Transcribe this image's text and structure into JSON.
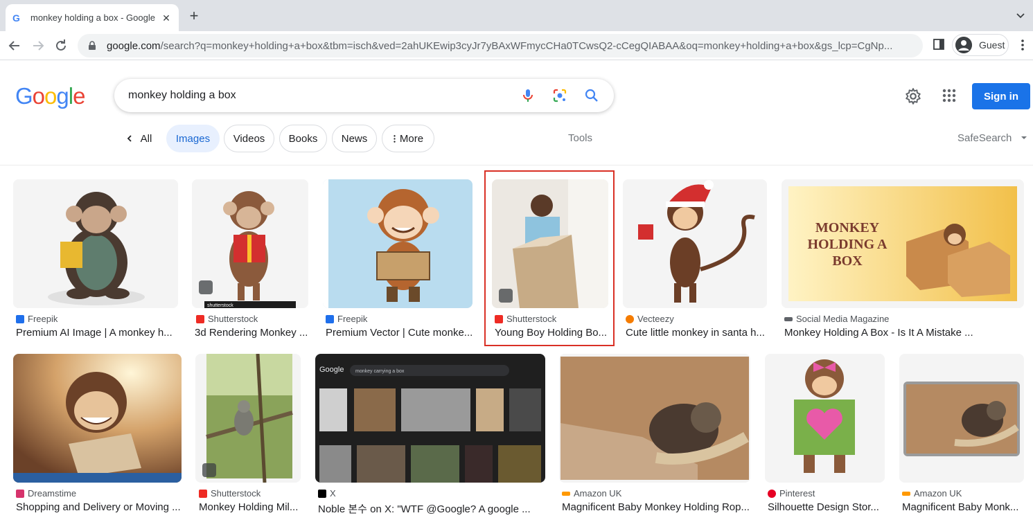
{
  "browser": {
    "tab_title": "monkey holding a box - Google",
    "tab_favicon": "G",
    "new_tab_label": "+",
    "url_host": "google.com",
    "url_rest": "/search?q=monkey+holding+a+box&tbm=isch&ved=2ahUKEwip3cyJr7yBAxWFmycCHa0TCwsQ2-cCegQIABAA&oq=monkey+holding+a+box&gs_lcp=CgNp...",
    "profile_label": "Guest"
  },
  "google": {
    "logo_letters": [
      "G",
      "o",
      "o",
      "g",
      "l",
      "e"
    ],
    "logo_colors": [
      "#4285f4",
      "#ea4335",
      "#fbbc05",
      "#4285f4",
      "#34a853",
      "#ea4335"
    ],
    "query": "monkey holding a box",
    "sign_in_label": "Sign in",
    "filters": {
      "all": "All",
      "images": "Images",
      "videos": "Videos",
      "books": "Books",
      "news": "News",
      "more": "More",
      "tools": "Tools",
      "safesearch": "SafeSearch"
    }
  },
  "results": [
    {
      "source": "Freepik",
      "title": "Premium AI Image | A monkey h...",
      "source_color": "#1f6feb"
    },
    {
      "source": "Shutterstock",
      "title": "3d Rendering Monkey ...",
      "source_color": "#ee2b24"
    },
    {
      "source": "Freepik",
      "title": "Premium Vector | Cute monke...",
      "source_color": "#1f6feb"
    },
    {
      "source": "Shutterstock",
      "title": "Young Boy Holding Bo...",
      "source_color": "#ee2b24"
    },
    {
      "source": "Vecteezy",
      "title": "Cute little monkey in santa h...",
      "source_color": "#f57c00"
    },
    {
      "source": "Social Media Magazine",
      "title": "Monkey Holding A Box - Is It A Mistake ...",
      "source_color": "#5f6368"
    },
    {
      "source": "Dreamstime",
      "title": "Shopping and Delivery or Moving ...",
      "source_color": "#d6336c"
    },
    {
      "source": "Shutterstock",
      "title": "Monkey Holding Mil...",
      "source_color": "#ee2b24"
    },
    {
      "source": "X",
      "title": "Noble 본수 on X: \"WTF @Google? A google ...",
      "source_color": "#000000"
    },
    {
      "source": "Amazon UK",
      "title": "Magnificent Baby Monkey Holding Rop...",
      "source_color": "#ff9900"
    },
    {
      "source": "Pinterest",
      "title": "Silhouette Design Stor...",
      "source_color": "#e60023"
    },
    {
      "source": "Amazon UK",
      "title": "Magnificent Baby Monk...",
      "source_color": "#ff9900"
    }
  ],
  "thumb_texts": {
    "monkey_box_banner": "MONKEY HOLDING A BOX",
    "shutterstock_strip": "shutterstock",
    "screenshot_query": "monkey carrying a box",
    "screenshot_logo": "Google"
  }
}
